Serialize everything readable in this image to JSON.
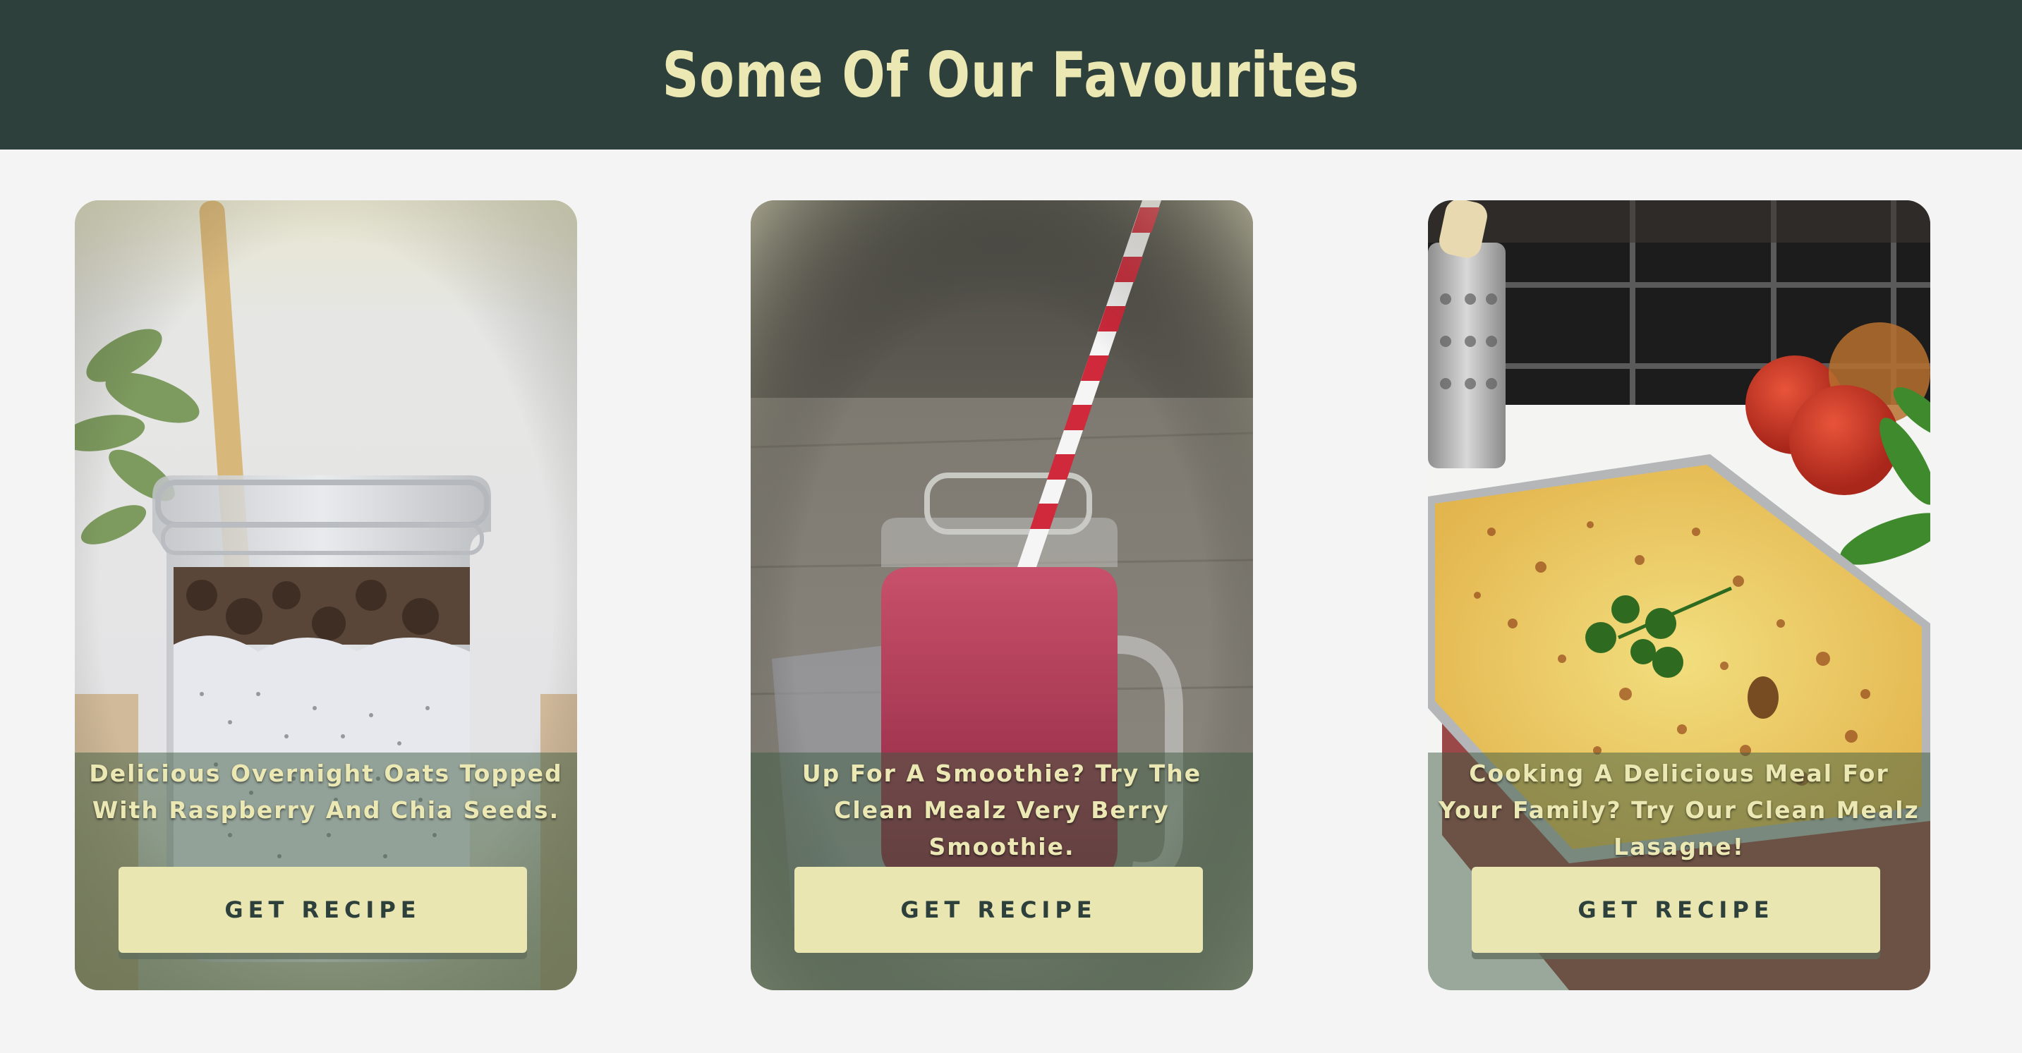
{
  "header": {
    "title": "Some Of Our Favourites"
  },
  "cards": [
    {
      "caption": "Delicious Overnight Oats Topped With Raspberry And Chia Seeds.",
      "button": "GET RECIPE",
      "image": "overnight-oats-jar"
    },
    {
      "caption": "Up For A Smoothie? Try The Clean Mealz Very Berry Smoothie.",
      "button": "GET RECIPE",
      "image": "berry-smoothie-jar"
    },
    {
      "caption": "Cooking A Delicious Meal For Your Family? Try Our Clean Mealz Lasagne!",
      "button": "GET RECIPE",
      "image": "lasagne-tray"
    }
  ],
  "colors": {
    "header_bg": "#2e403b",
    "accent": "#ebe8b4",
    "page_bg": "#f4f4f4",
    "button_bg": "#e9e6b2",
    "button_text": "#2e403b"
  }
}
